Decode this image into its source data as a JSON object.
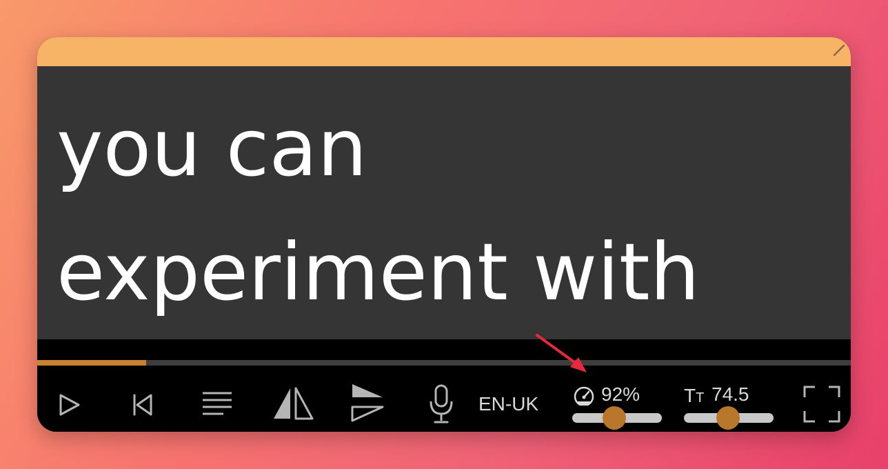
{
  "caption": {
    "line1": "you can",
    "line2": "experiment with"
  },
  "progress": {
    "fraction": 0.134
  },
  "controls": {
    "language_label": "EN-UK",
    "speed_label": "92%",
    "speed_fraction": 0.47,
    "size_label": "74.5",
    "size_fraction": 0.49
  },
  "colors": {
    "topbar": "#f7b366",
    "accent": "#c98330",
    "slider_thumb": "#b8772b",
    "annotation_arrow": "#e8283f"
  },
  "icons": {
    "play": "play-icon",
    "previous": "skip-back-icon",
    "text": "text-align-icon",
    "mirror": "mirror-icon",
    "direction": "flip-vertical-icon",
    "mic": "microphone-icon",
    "speed": "speedometer-icon",
    "size": "text-size-icon",
    "fullscreen": "fullscreen-icon"
  }
}
